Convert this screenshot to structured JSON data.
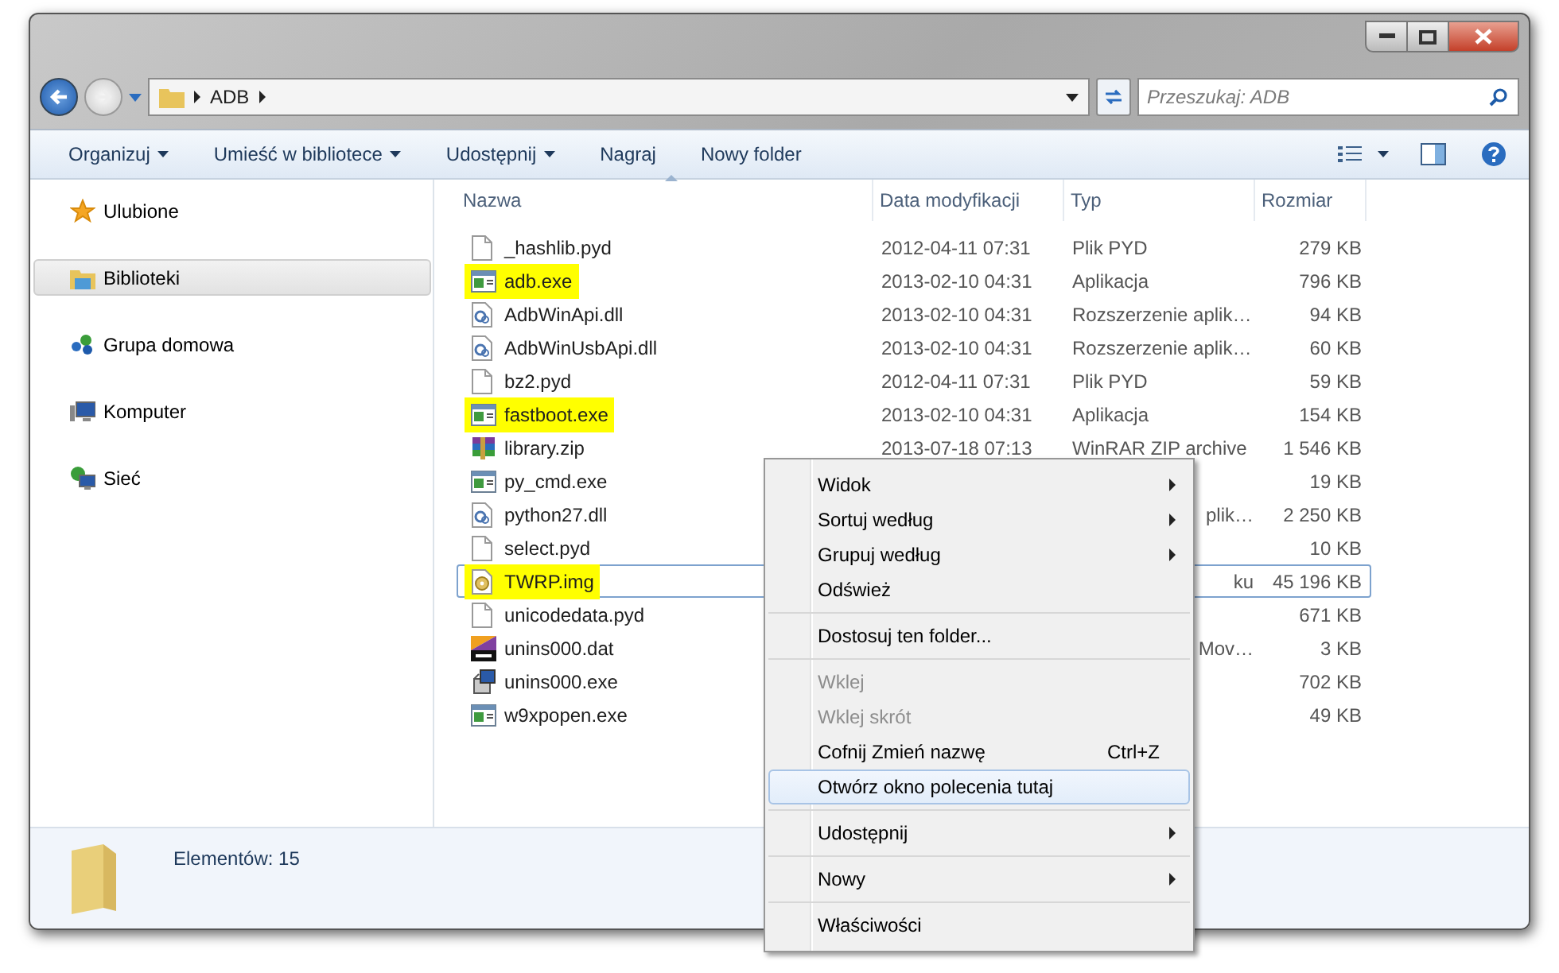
{
  "window": {
    "path": [
      "ADB"
    ],
    "search": {
      "placeholder": "Przeszukaj: ADB"
    }
  },
  "toolbar": [
    {
      "label": "Organizuj",
      "dropdown": true
    },
    {
      "label": "Umieść w bibliotece",
      "dropdown": true
    },
    {
      "label": "Udostępnij",
      "dropdown": true
    },
    {
      "label": "Nagraj",
      "dropdown": false
    },
    {
      "label": "Nowy folder",
      "dropdown": false
    }
  ],
  "sidebar": {
    "items": [
      {
        "label": "Ulubione",
        "kind": "favorites",
        "selected": false
      },
      {
        "label": "Biblioteki",
        "kind": "libraries",
        "selected": true
      },
      {
        "label": "Grupa domowa",
        "kind": "homegroup",
        "selected": false
      },
      {
        "label": "Komputer",
        "kind": "computer",
        "selected": false
      },
      {
        "label": "Sieć",
        "kind": "network",
        "selected": false
      }
    ]
  },
  "table": {
    "columns": [
      {
        "label": "Nazwa",
        "sorted": true
      },
      {
        "label": "Data modyfikacji",
        "sorted": false
      },
      {
        "label": "Typ",
        "sorted": false
      },
      {
        "label": "Rozmiar",
        "sorted": false
      }
    ],
    "rows": [
      {
        "kind": "file",
        "name": "_hashlib.pyd",
        "date": "2012-04-11 07:31",
        "type": "Plik PYD",
        "size": "279 KB",
        "highlighted": false,
        "focused": false
      },
      {
        "kind": "app",
        "name": "adb.exe",
        "date": "2013-02-10 04:31",
        "type": "Aplikacja",
        "size": "796 KB",
        "highlighted": true,
        "focused": false
      },
      {
        "kind": "dll",
        "name": "AdbWinApi.dll",
        "date": "2013-02-10 04:31",
        "type": "Rozszerzenie aplik…",
        "size": "94 KB",
        "highlighted": false,
        "focused": false
      },
      {
        "kind": "dll",
        "name": "AdbWinUsbApi.dll",
        "date": "2013-02-10 04:31",
        "type": "Rozszerzenie aplik…",
        "size": "60 KB",
        "highlighted": false,
        "focused": false
      },
      {
        "kind": "file",
        "name": "bz2.pyd",
        "date": "2012-04-11 07:31",
        "type": "Plik PYD",
        "size": "59 KB",
        "highlighted": false,
        "focused": false
      },
      {
        "kind": "app",
        "name": "fastboot.exe",
        "date": "2013-02-10 04:31",
        "type": "Aplikacja",
        "size": "154 KB",
        "highlighted": true,
        "focused": false
      },
      {
        "kind": "zip",
        "name": "library.zip",
        "date": "2013-07-18 07:13",
        "type": "WinRAR ZIP archive",
        "size": "1 546 KB",
        "highlighted": false,
        "focused": false
      },
      {
        "kind": "app",
        "name": "py_cmd.exe",
        "size": "19 KB",
        "highlighted": false,
        "focused": false
      },
      {
        "kind": "dll",
        "name": "python27.dll",
        "type_tail": "plik…",
        "size": "2 250 KB",
        "highlighted": false,
        "focused": false
      },
      {
        "kind": "file",
        "name": "select.pyd",
        "size": "10 KB",
        "highlighted": false,
        "focused": false
      },
      {
        "kind": "image",
        "name": "TWRP.img",
        "type_tail": "ku",
        "size": "45 196 KB",
        "highlighted": true,
        "focused": true
      },
      {
        "kind": "file",
        "name": "unicodedata.pyd",
        "size": "671 KB",
        "highlighted": false,
        "focused": false
      },
      {
        "kind": "dat",
        "name": "unins000.dat",
        "type_tail": "Mov…",
        "size": "3 KB",
        "highlighted": false,
        "focused": false
      },
      {
        "kind": "installer",
        "name": "unins000.exe",
        "size": "702 KB",
        "highlighted": false,
        "focused": false
      },
      {
        "kind": "app",
        "name": "w9xpopen.exe",
        "size": "49 KB",
        "highlighted": false,
        "focused": false
      }
    ]
  },
  "status_bar": {
    "text": "Elementów: 15"
  },
  "context_menu": {
    "groups": [
      [
        {
          "label": "Widok",
          "submenu": true,
          "disabled": false,
          "selected": false
        },
        {
          "label": "Sortuj według",
          "submenu": true,
          "disabled": false,
          "selected": false
        },
        {
          "label": "Grupuj według",
          "submenu": true,
          "disabled": false,
          "selected": false
        },
        {
          "label": "Odśwież",
          "submenu": false,
          "disabled": false,
          "selected": false
        }
      ],
      [
        {
          "label": "Dostosuj ten folder...",
          "submenu": false,
          "disabled": false,
          "selected": false
        }
      ],
      [
        {
          "label": "Wklej",
          "submenu": false,
          "disabled": true,
          "selected": false
        },
        {
          "label": "Wklej skrót",
          "submenu": false,
          "disabled": true,
          "selected": false
        },
        {
          "label": "Cofnij Zmień nazwę",
          "shortcut": "Ctrl+Z",
          "submenu": false,
          "disabled": false,
          "selected": false
        },
        {
          "label": "Otwórz okno polecenia tutaj",
          "submenu": false,
          "disabled": false,
          "selected": true
        }
      ],
      [
        {
          "label": "Udostępnij",
          "submenu": true,
          "disabled": false,
          "selected": false
        }
      ],
      [
        {
          "label": "Nowy",
          "submenu": true,
          "disabled": false,
          "selected": false
        }
      ],
      [
        {
          "label": "Właściwości",
          "submenu": false,
          "disabled": false,
          "selected": false
        }
      ]
    ]
  }
}
